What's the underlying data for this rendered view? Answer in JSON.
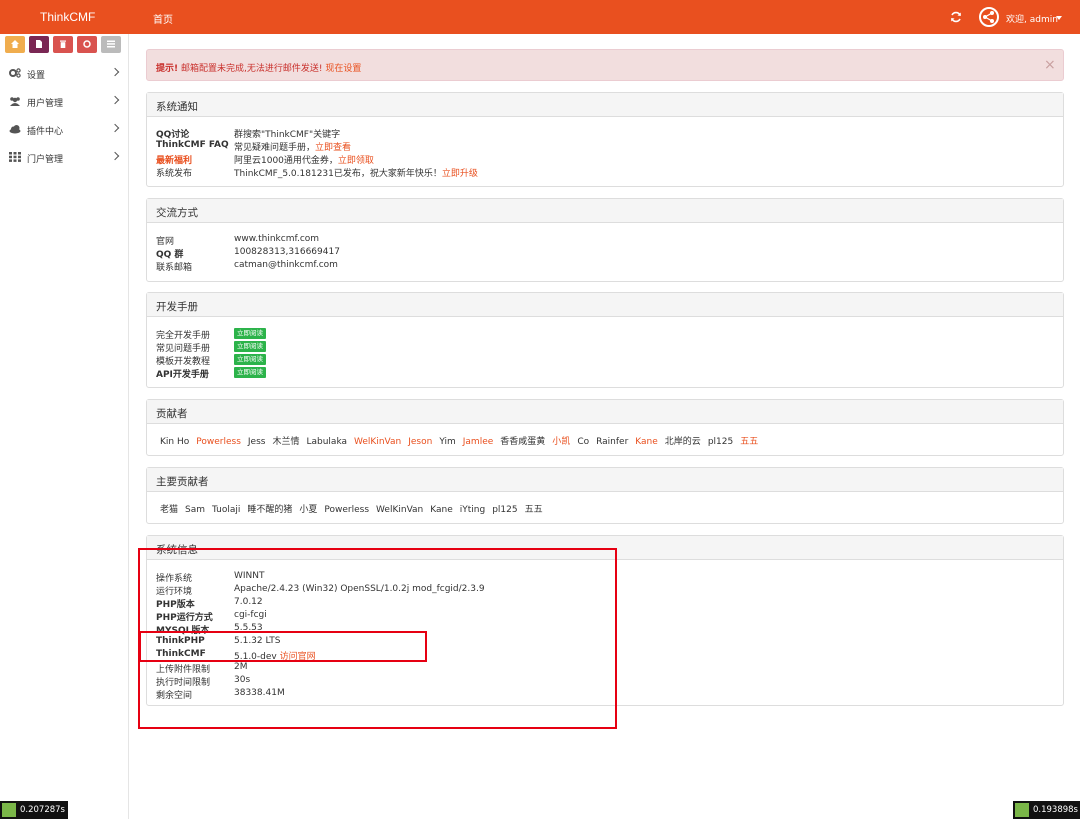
{
  "header": {
    "brand": "ThinkCMF",
    "nav_home": "首页",
    "welcome": "欢迎, admin"
  },
  "colors": {
    "accent": "#e9501f",
    "danger_text": "#c9302c",
    "badge_green": "#2cb34a"
  },
  "quick_buttons": [
    {
      "name": "home-icon",
      "color": "#f0ad4e"
    },
    {
      "name": "file-icon",
      "color": "#7a2754"
    },
    {
      "name": "trash-icon",
      "color": "#d9534f"
    },
    {
      "name": "recycle-icon",
      "color": "#d9534f"
    },
    {
      "name": "list-icon",
      "color": "#bbbbbb"
    }
  ],
  "sidebar": {
    "items": [
      {
        "label": "设置",
        "icon": "gears-icon"
      },
      {
        "label": "用户管理",
        "icon": "users-icon"
      },
      {
        "label": "插件中心",
        "icon": "cloud-icon"
      },
      {
        "label": "门户管理",
        "icon": "grid-icon"
      }
    ]
  },
  "alert": {
    "strong": "提示!",
    "text": " 邮箱配置未完成,无法进行邮件发送! ",
    "link": "现在设置",
    "close": "×"
  },
  "notice": {
    "title": "系统通知",
    "rows": [
      {
        "key": "QQ讨论",
        "value": "群搜索\"ThinkCMF\"关键字",
        "link": ""
      },
      {
        "key": "ThinkCMF FAQ",
        "value": "常见疑难问题手册，",
        "link": "立即查看"
      },
      {
        "key": "最新福利",
        "value": "阿里云1000通用代金券，",
        "link": "立即领取"
      },
      {
        "key": "系统发布",
        "value": "ThinkCMF_5.0.181231已发布，祝大家新年快乐！",
        "link": "立即升级"
      }
    ]
  },
  "contact": {
    "title": "交流方式",
    "rows": [
      {
        "key": "官网",
        "value": "www.thinkcmf.com"
      },
      {
        "key": "QQ 群",
        "value": "100828313,316669417"
      },
      {
        "key": "联系邮箱",
        "value": "catman@thinkcmf.com"
      }
    ]
  },
  "manual": {
    "title": "开发手册",
    "badge": "立即阅读",
    "rows": [
      {
        "key": "完全开发手册"
      },
      {
        "key": "常见问题手册"
      },
      {
        "key": "模板开发教程"
      },
      {
        "key": "API开发手册"
      }
    ]
  },
  "contributors": {
    "title": "贡献者",
    "names": [
      {
        "name": "Kin Ho",
        "hl": false
      },
      {
        "name": "Powerless",
        "hl": true
      },
      {
        "name": "Jess",
        "hl": false
      },
      {
        "name": "木兰情",
        "hl": false
      },
      {
        "name": "Labulaka",
        "hl": false
      },
      {
        "name": "WelKinVan",
        "hl": true
      },
      {
        "name": "Jeson",
        "hl": true
      },
      {
        "name": "Yim",
        "hl": false
      },
      {
        "name": "Jamlee",
        "hl": true
      },
      {
        "name": "香香咸蛋黄",
        "hl": false
      },
      {
        "name": "小凯",
        "hl": true
      },
      {
        "name": "Co",
        "hl": false
      },
      {
        "name": "Rainfer",
        "hl": false
      },
      {
        "name": "Kane",
        "hl": true
      },
      {
        "name": "北岸的云",
        "hl": false
      },
      {
        "name": "pl125",
        "hl": false
      },
      {
        "name": "五五",
        "hl": true
      }
    ]
  },
  "main_contributors": {
    "title": "主要贡献者",
    "names": [
      "老猫",
      "Sam",
      "Tuolaji",
      "睡不醒的猪",
      "小夏",
      "Powerless",
      "WelKinVan",
      "Kane",
      "iYting",
      "pl125",
      "五五"
    ]
  },
  "sysinfo": {
    "title": "系统信息",
    "rows": [
      {
        "key": "操作系统",
        "value": "WINNT",
        "bold": false,
        "link": ""
      },
      {
        "key": "运行环境",
        "value": "Apache/2.4.23 (Win32) OpenSSL/1.0.2j mod_fcgid/2.3.9",
        "bold": false,
        "link": ""
      },
      {
        "key": "PHP版本",
        "value": "7.0.12",
        "bold": true,
        "link": ""
      },
      {
        "key": "PHP运行方式",
        "value": "cgi-fcgi",
        "bold": true,
        "link": ""
      },
      {
        "key": "MYSQL版本",
        "value": "5.5.53",
        "bold": true,
        "link": ""
      },
      {
        "key": "ThinkPHP",
        "value": "5.1.32 LTS",
        "bold": true,
        "link": ""
      },
      {
        "key": "ThinkCMF",
        "value": "5.1.0-dev ",
        "bold": true,
        "link": "访问官网"
      },
      {
        "key": "上传附件限制",
        "value": "2M",
        "bold": false,
        "link": ""
      },
      {
        "key": "执行时间限制",
        "value": "30s",
        "bold": false,
        "link": ""
      },
      {
        "key": "剩余空间",
        "value": "38338.41M",
        "bold": false,
        "link": ""
      }
    ]
  },
  "timers": {
    "left": "0.207287s",
    "right": "0.193898s"
  }
}
